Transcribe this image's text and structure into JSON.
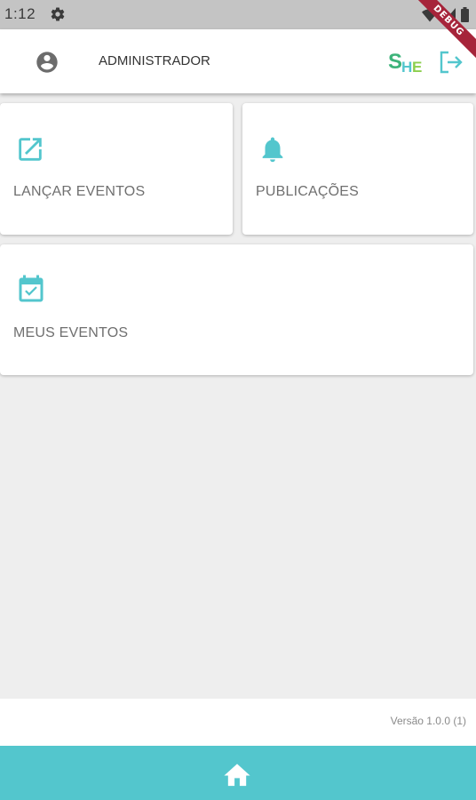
{
  "status_bar": {
    "time": "1:12"
  },
  "debug_banner": "DEBUG",
  "header": {
    "user_name": "ADMINISTRADOR",
    "logo_text": "SHE"
  },
  "cards": [
    {
      "label": "LANÇAR EVENTOS",
      "icon": "launch-icon"
    },
    {
      "label": "PUBLICAÇÕES",
      "icon": "bell-icon"
    },
    {
      "label": "MEUS EVENTOS",
      "icon": "calendar-check-icon"
    }
  ],
  "footer": {
    "version": "Versão 1.0.0 (1)"
  },
  "bottom_nav": {
    "icon": "home-icon"
  },
  "colors": {
    "accent": "#53c6cd",
    "status_bar": "#c4c4c4",
    "background": "#eeeeee",
    "debug": "#a6243a"
  }
}
